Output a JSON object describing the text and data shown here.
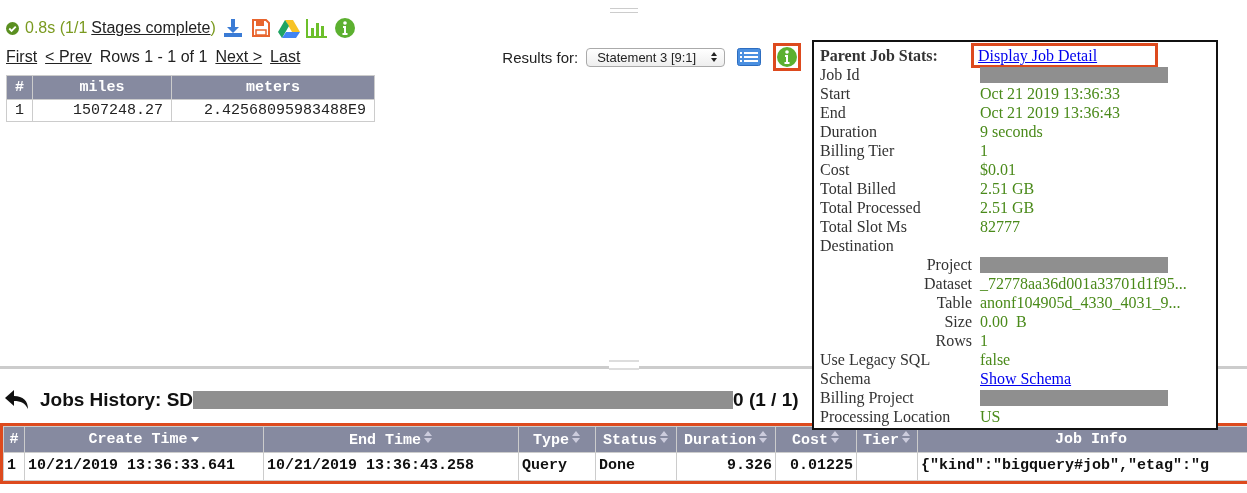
{
  "status": {
    "time": "0.8s",
    "stages_open": "(1/1",
    "stages_link": "Stages complete",
    "stages_close": ")"
  },
  "toolbar_icons": [
    {
      "kind": "download"
    },
    {
      "kind": "save"
    },
    {
      "kind": "drive"
    },
    {
      "kind": "chart"
    },
    {
      "kind": "info"
    }
  ],
  "pager": {
    "first": "First",
    "prev": "< Prev",
    "rows": "Rows 1 - 1 of 1",
    "next": "Next >",
    "last": "Last"
  },
  "results_for": {
    "label": "Results for:",
    "value": "Statement 3 [9:1]"
  },
  "view_buttons": [
    {
      "kind": "list",
      "highlighted": false
    },
    {
      "kind": "info",
      "highlighted": true
    }
  ],
  "results_table": {
    "columns": [
      "#",
      "miles",
      "meters"
    ],
    "rows": [
      [
        "1",
        "1507248.27",
        "2.42568095983488E9"
      ]
    ]
  },
  "job_stats": {
    "title": "Parent Job Stats:",
    "link": {
      "text": "Display Job Detail",
      "highlighted": true
    },
    "rows": [
      {
        "label": "Job Id",
        "kind": "redacted"
      },
      {
        "label": "Start",
        "kind": "text",
        "value": "Oct 21 2019 13:36:33"
      },
      {
        "label": "End",
        "kind": "text",
        "value": "Oct 21 2019 13:36:43"
      },
      {
        "label": "Duration",
        "kind": "text",
        "value": "9 seconds"
      },
      {
        "label": "Billing Tier",
        "kind": "text",
        "value": "1"
      },
      {
        "label": "Cost",
        "kind": "text",
        "value": "$0.01"
      },
      {
        "label": "Total Billed",
        "kind": "text",
        "value": "2.51 GB"
      },
      {
        "label": "Total Processed",
        "kind": "text",
        "value": "2.51 GB"
      },
      {
        "label": "Total Slot Ms",
        "kind": "text",
        "value": "82777"
      },
      {
        "label": "Destination",
        "kind": "group",
        "children": [
          {
            "label": "Project",
            "kind": "redacted"
          },
          {
            "label": "Dataset",
            "kind": "text",
            "value": "_72778aa36d001a33701d1f95..."
          },
          {
            "label": "Table",
            "kind": "text",
            "value": "anonf104905d_4330_4031_9..."
          },
          {
            "label": "Size",
            "kind": "text",
            "value": "0.00  B"
          },
          {
            "label": "Rows",
            "kind": "text",
            "value": "1"
          }
        ]
      },
      {
        "label": "Use Legacy SQL",
        "kind": "text",
        "value": "false"
      },
      {
        "label": "Schema",
        "kind": "link",
        "value": "Show Schema"
      },
      {
        "label": "Billing Project",
        "kind": "redacted"
      },
      {
        "label": "Processing Location",
        "kind": "text",
        "value": "US"
      }
    ]
  },
  "jobs_history": {
    "title": "Jobs History: SD",
    "suffix": "0 (1 / 1)",
    "table": {
      "highlighted": true,
      "columns": [
        {
          "label": "#",
          "sortable": false
        },
        {
          "label": "Create Time",
          "sortable": true,
          "sorted": true
        },
        {
          "label": "End Time",
          "sortable": true,
          "sorted": false
        },
        {
          "label": "Type",
          "sortable": true,
          "sorted": false
        },
        {
          "label": "Status",
          "sortable": true,
          "sorted": false
        },
        {
          "label": "Duration",
          "sortable": true,
          "sorted": false
        },
        {
          "label": "Cost",
          "sortable": true,
          "sorted": false
        },
        {
          "label": "Tier",
          "sortable": true,
          "sorted": false
        },
        {
          "label": "Job Info",
          "sortable": false
        }
      ],
      "rows": [
        [
          "1",
          "10/21/2019 13:36:33.641",
          "10/21/2019 13:36:43.258",
          "Query",
          "Done",
          "9.326",
          "0.01225",
          "",
          "{\"kind\":\"bigquery#job\",\"etag\":\"g"
        ]
      ]
    }
  }
}
